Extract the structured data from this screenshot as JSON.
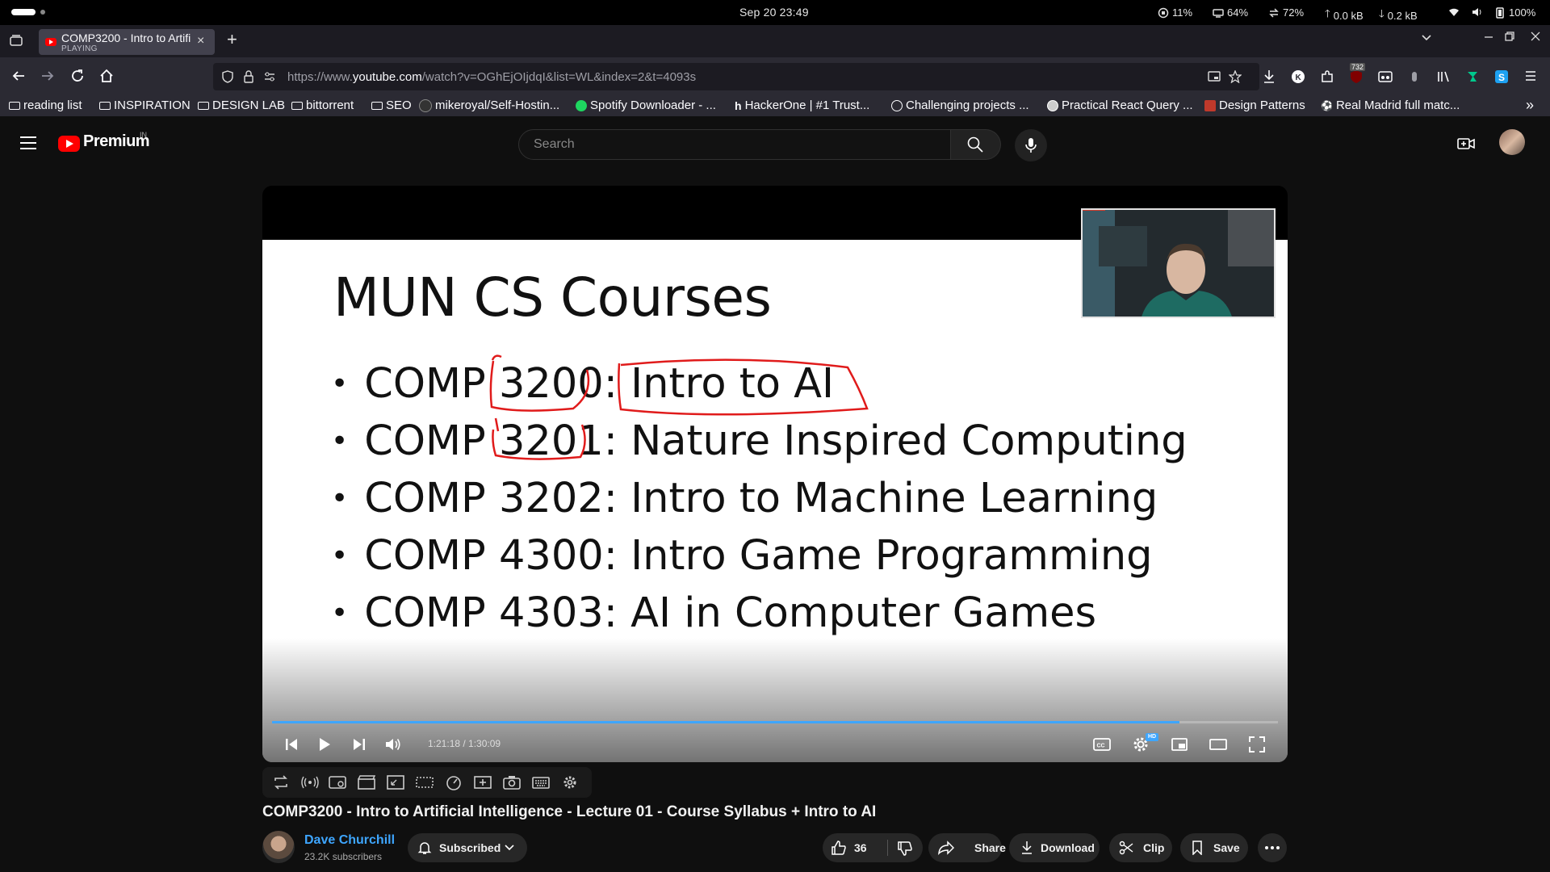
{
  "os_bar": {
    "datetime": "Sep 20 23:49",
    "cpu": "11%",
    "memory": "64%",
    "swap": "72%",
    "upload": "0.0 kB",
    "download": "0.2 kB",
    "battery": "100%"
  },
  "browser": {
    "tab": {
      "title": "COMP3200 - Intro to Artificial Intelligence",
      "status": "PLAYING",
      "close": "×"
    },
    "new_tab": "+",
    "url_prefix": "https://www.",
    "url_host": "youtube.com",
    "url_path": "/watch?v=OGhEjOIjdqI&list=WL&index=2&t=4093s",
    "extension_badge": "732",
    "bookmarks": [
      "reading list",
      "INSPIRATION",
      "DESIGN LAB",
      "bittorrent",
      "SEO",
      "mikeroyal/Self-Hostin...",
      "Spotify Downloader - ...",
      "HackerOne | #1 Trust...",
      "Challenging projects ...",
      "Practical React Query ...",
      "Design Patterns",
      "Real Madrid full matc..."
    ],
    "bookmarks_overflow": "»"
  },
  "youtube": {
    "logo_text": "Premium",
    "region": "IN",
    "search_placeholder": "Search"
  },
  "player": {
    "slide_title": "MUN CS Courses",
    "slide_items": [
      "COMP 3200: Intro to AI",
      "COMP 3201: Nature Inspired Computing",
      "COMP 3202: Intro to Machine Learning",
      "COMP 4300: Intro Game Programming",
      "COMP 4303: AI in Computer Games"
    ],
    "time_display": "1:21:18 / 1:30:09",
    "progress_fraction": 0.902,
    "quality_badge": "HD",
    "accent_color": "#3ea6ff"
  },
  "video": {
    "title": "COMP3200 - Intro to Artificial Intelligence - Lecture 01 - Course Syllabus + Intro to AI",
    "channel": "Dave Churchill",
    "subscribers": "23.2K subscribers",
    "subscribe_label": "Subscribed",
    "likes": "36",
    "share_label": "Share",
    "download_label": "Download",
    "clip_label": "Clip",
    "save_label": "Save"
  }
}
